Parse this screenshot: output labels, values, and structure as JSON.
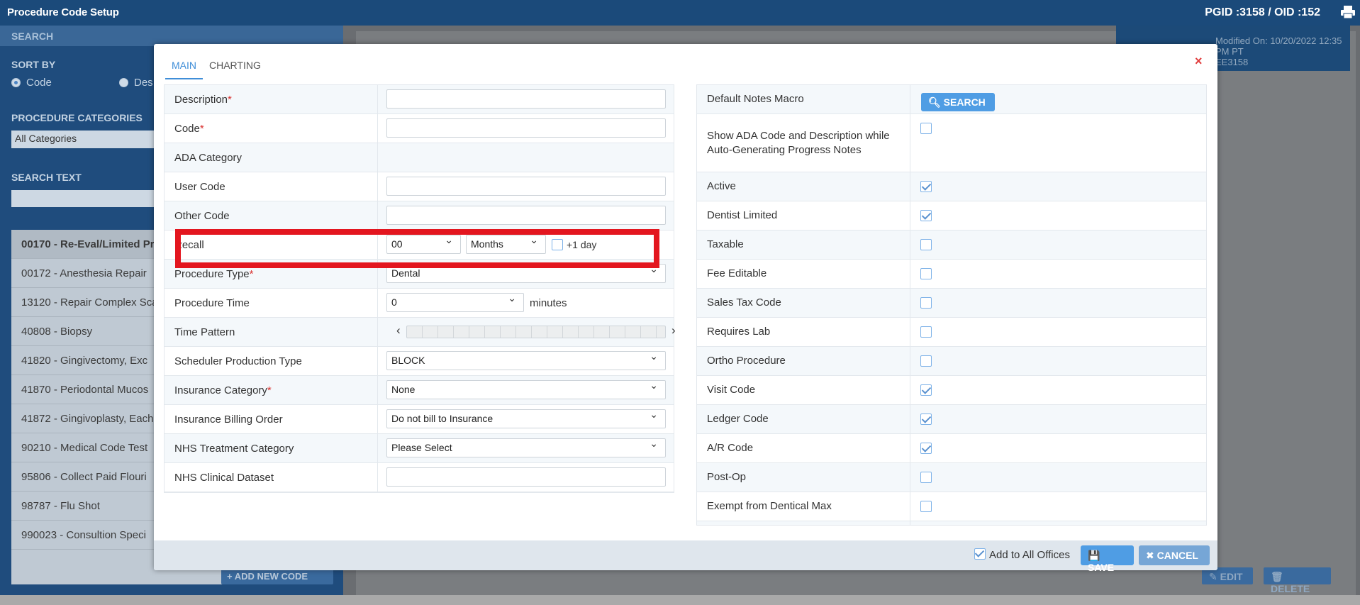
{
  "app": {
    "title": "Procedure Code Setup",
    "ids": "PGID :3158  /  OID :152",
    "modified": "Modified On: 10/20/2022 12:35 PM PT",
    "modified_by": "EE3158"
  },
  "sidebar": {
    "search_header": "SEARCH",
    "sort_by": "SORT BY",
    "sort_options": [
      "Code",
      "Des"
    ],
    "categories_label": "PROCEDURE CATEGORIES",
    "categories_value": "All Categories",
    "search_text_label": "SEARCH TEXT",
    "codes": [
      "00170 - Re-Eval/Limited Pr",
      "00172 - Anesthesia Repair",
      "13120 - Repair Complex Sca",
      "40808 - Biopsy",
      "41820 - Gingivectomy, Exc",
      "41870 - Periodontal Mucos",
      "41872 - Gingivoplasty, Each",
      "90210 - Medical Code Test",
      "95806 - Collect Paid Flouri",
      "98787 - Flu Shot",
      "990023 - Consultion Speci"
    ],
    "add_new_code": "ADD NEW CODE"
  },
  "background_buttons": {
    "edit": "EDIT",
    "delete": "DELETE"
  },
  "modal": {
    "tabs": [
      "MAIN",
      "CHARTING"
    ],
    "close": "×",
    "left_rows": [
      {
        "label": "Description",
        "required": "*"
      },
      {
        "label": "Code",
        "required": "*"
      },
      {
        "label": "ADA Category"
      },
      {
        "label": "User Code"
      },
      {
        "label": "Other Code"
      },
      {
        "label": "Recall"
      },
      {
        "label": "Procedure Type",
        "required": "*"
      },
      {
        "label": "Procedure Time"
      },
      {
        "label": "Time Pattern"
      },
      {
        "label": "Scheduler Production Type"
      },
      {
        "label": "Insurance Category",
        "required": "*"
      },
      {
        "label": "Insurance Billing Order"
      },
      {
        "label": "NHS Treatment Category"
      },
      {
        "label": "NHS Clinical Dataset"
      }
    ],
    "recall": {
      "number": "00",
      "unit": "Months",
      "plus_day": "+1 day"
    },
    "procedure_type": "Dental",
    "procedure_time": {
      "value": "0",
      "unit": "minutes"
    },
    "scheduler_production_type": "BLOCK",
    "insurance_category": "None",
    "insurance_billing_order": "Do not bill to Insurance",
    "nhs_treatment_category": "Please Select",
    "right_rows": [
      {
        "label": "Default Notes Macro"
      },
      {
        "label": "Show ADA Code and Description while Auto-Generating Progress Notes",
        "checked": false
      },
      {
        "label": "Active",
        "checked": true
      },
      {
        "label": "Dentist Limited",
        "checked": true
      },
      {
        "label": "Taxable",
        "checked": false
      },
      {
        "label": "Fee Editable",
        "checked": false
      },
      {
        "label": "Sales Tax Code",
        "checked": false
      },
      {
        "label": "Requires Lab",
        "checked": false
      },
      {
        "label": "Ortho Procedure",
        "checked": false
      },
      {
        "label": "Visit Code",
        "checked": true
      },
      {
        "label": "Ledger Code",
        "checked": true
      },
      {
        "label": "A/R Code",
        "checked": true
      },
      {
        "label": "Post-Op",
        "checked": false
      },
      {
        "label": "Exempt from Dentical Max",
        "checked": false
      }
    ],
    "search_button": "SEARCH",
    "footer": {
      "add_to_all": "Add to All Offices",
      "add_to_all_checked": true,
      "save": "SAVE",
      "cancel": "CANCEL"
    }
  }
}
